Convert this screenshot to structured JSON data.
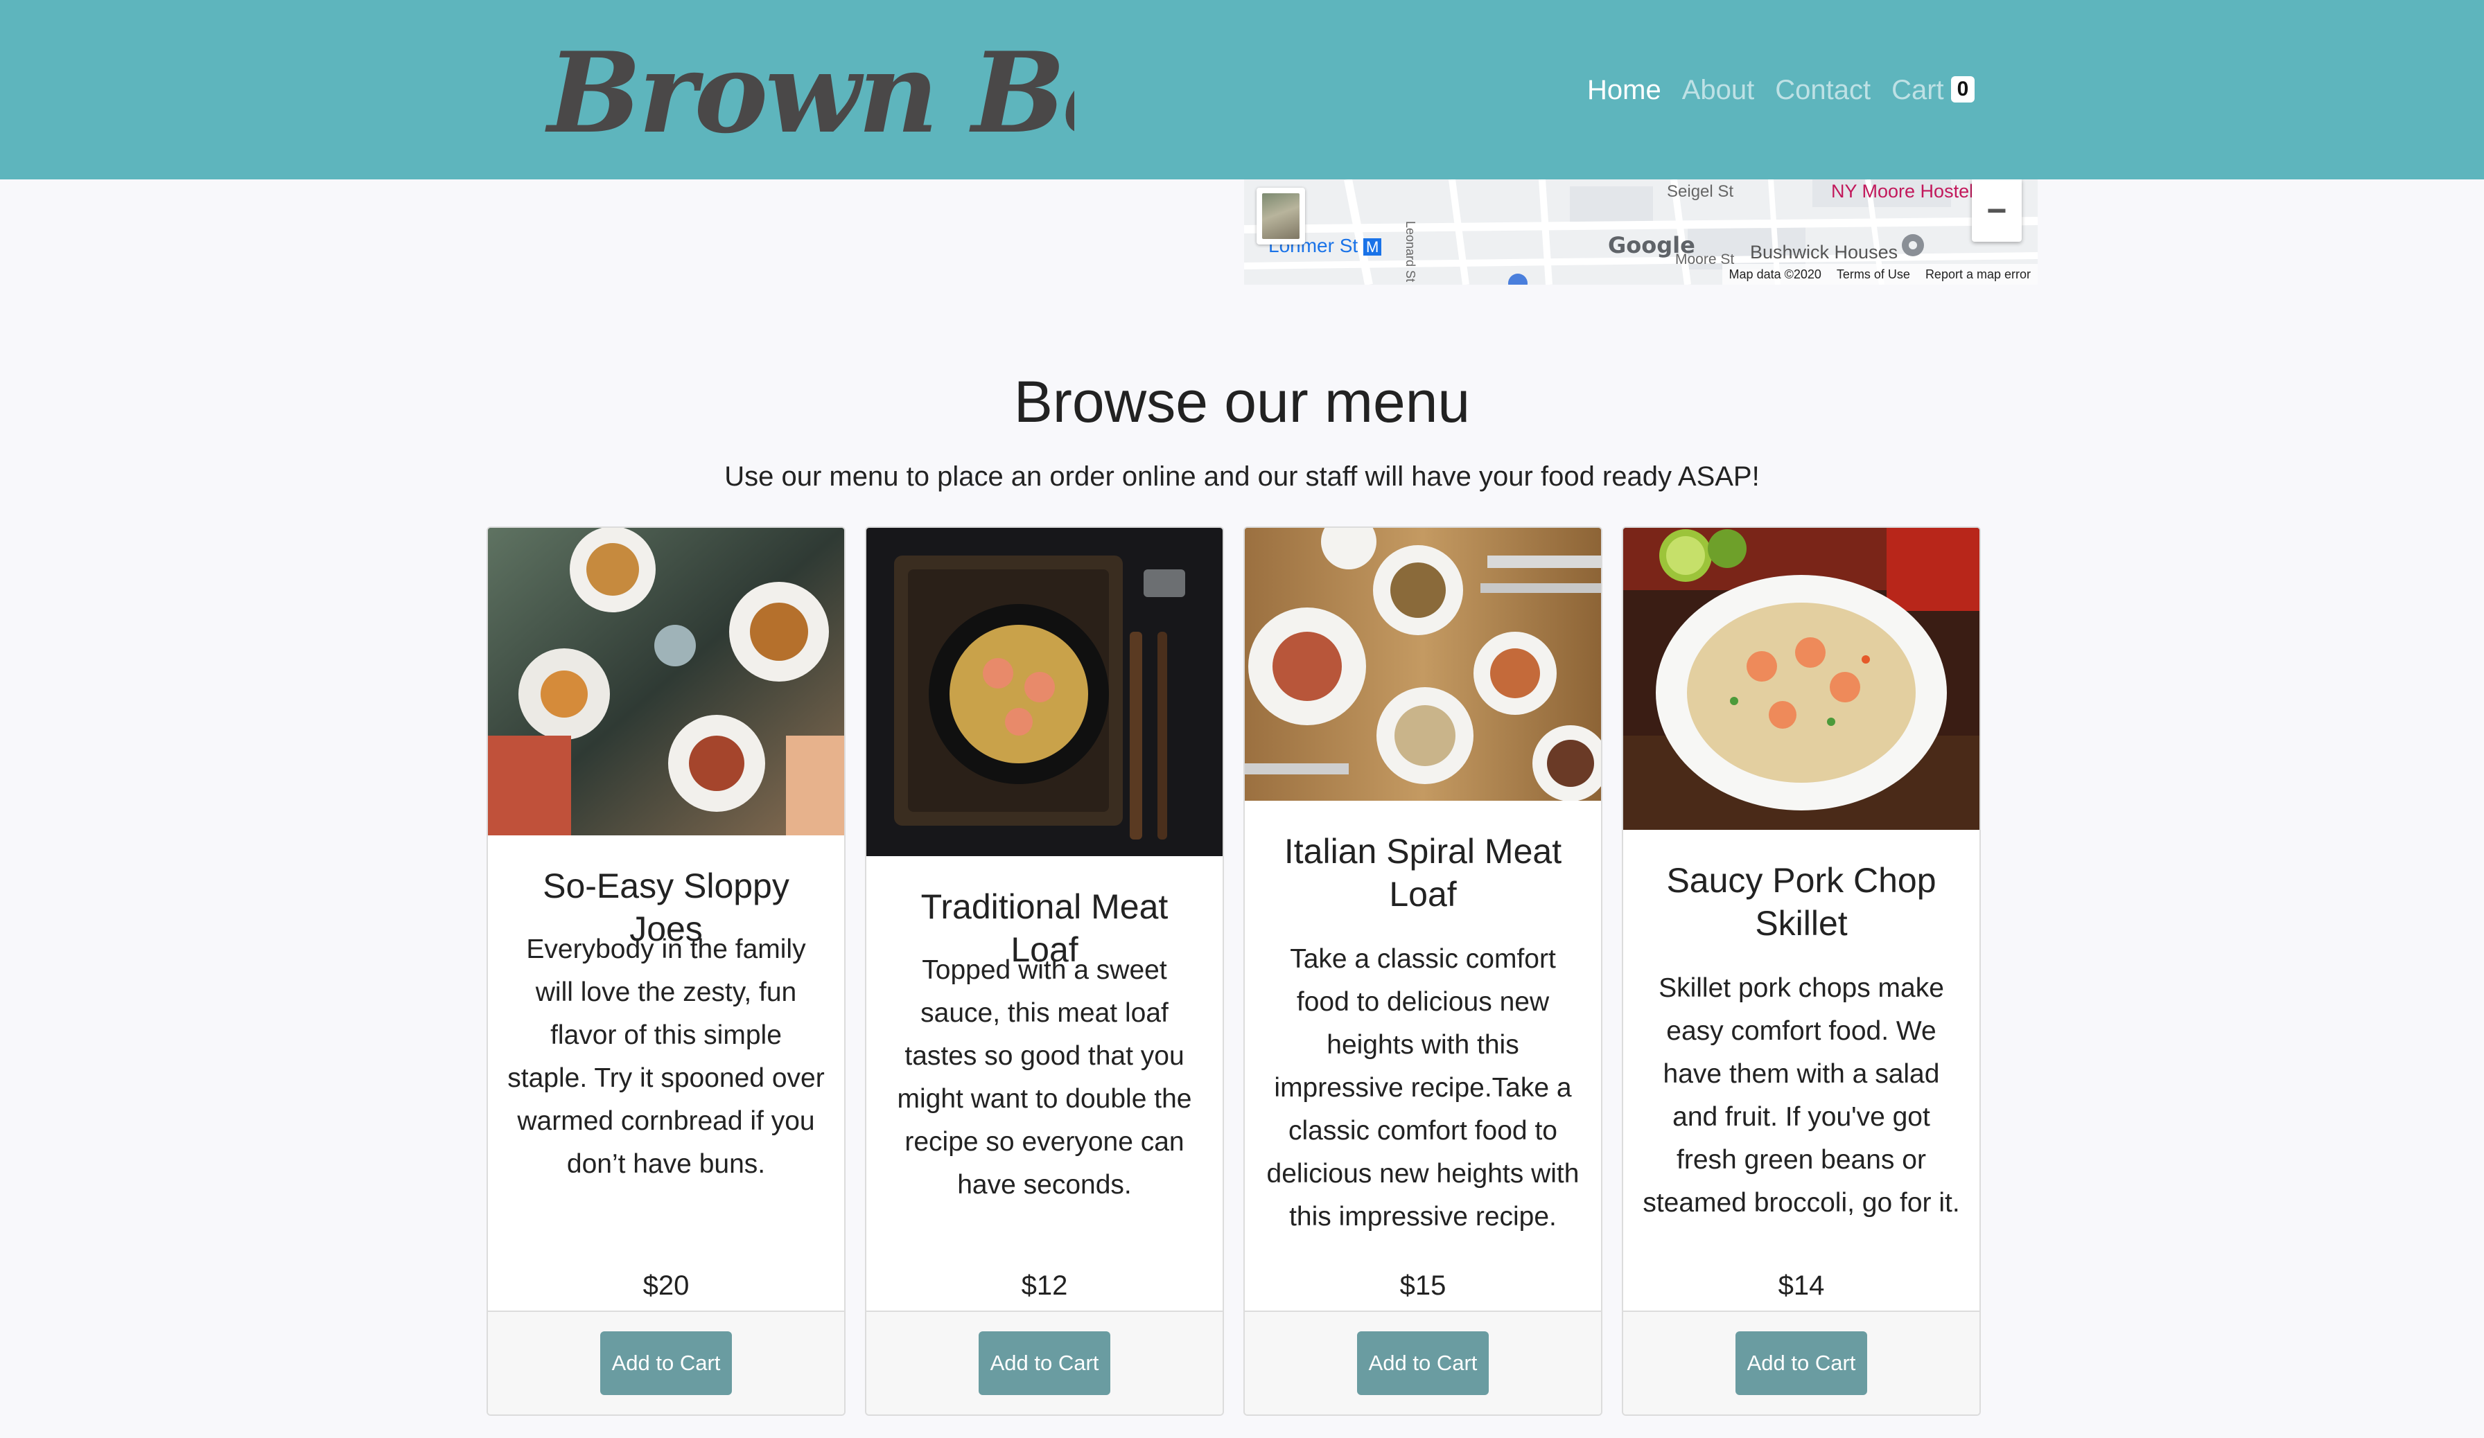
{
  "brand": {
    "name": "Brown Bag"
  },
  "nav": {
    "items": [
      {
        "label": "Home",
        "active": true
      },
      {
        "label": "About",
        "active": false
      },
      {
        "label": "Contact",
        "active": false
      },
      {
        "label": "Cart",
        "active": false
      }
    ],
    "cart_count": "0"
  },
  "map": {
    "labels": {
      "street_siegel": "Seigel St",
      "hostel": "NY Moore Hostel",
      "station": "Lorimer St",
      "station_icon": "M",
      "street_leonard": "Leonard St",
      "street_moore": "Moore St",
      "houses": "Bushwick Houses",
      "google": "Google"
    },
    "footer": {
      "data": "Map data ©2020",
      "terms": "Terms of Use",
      "report": "Report a map error"
    },
    "zoom_out": "−"
  },
  "menu": {
    "title": "Browse our menu",
    "subtitle": "Use our menu to place an order online and our staff will have your food ready ASAP!",
    "items": [
      {
        "title": "So-Easy Sloppy Joes",
        "description": "Everybody in the family will love the zesty, fun flavor of this simple staple. Try it spooned over warmed cornbread if you don’t have buns.",
        "price": "$20",
        "button": "Add to Cart"
      },
      {
        "title": "Traditional Meat Loaf",
        "description": "Topped with a sweet sauce, this meat loaf tastes so good that you might want to double the recipe so everyone can have seconds.",
        "price": "$12",
        "button": "Add to Cart"
      },
      {
        "title": "Italian Spiral Meat Loaf",
        "description": "Take a classic comfort food to delicious new heights with this impressive recipe.Take a classic comfort food to delicious new heights with this impressive recipe.",
        "price": "$15",
        "button": "Add to Cart"
      },
      {
        "title": "Saucy Pork Chop Skillet",
        "description": "Skillet pork chops make easy comfort food. We have them with a salad and fruit. If you've got fresh green beans or steamed broccoli, go for it.",
        "price": "$14",
        "button": "Add to Cart"
      }
    ]
  }
}
